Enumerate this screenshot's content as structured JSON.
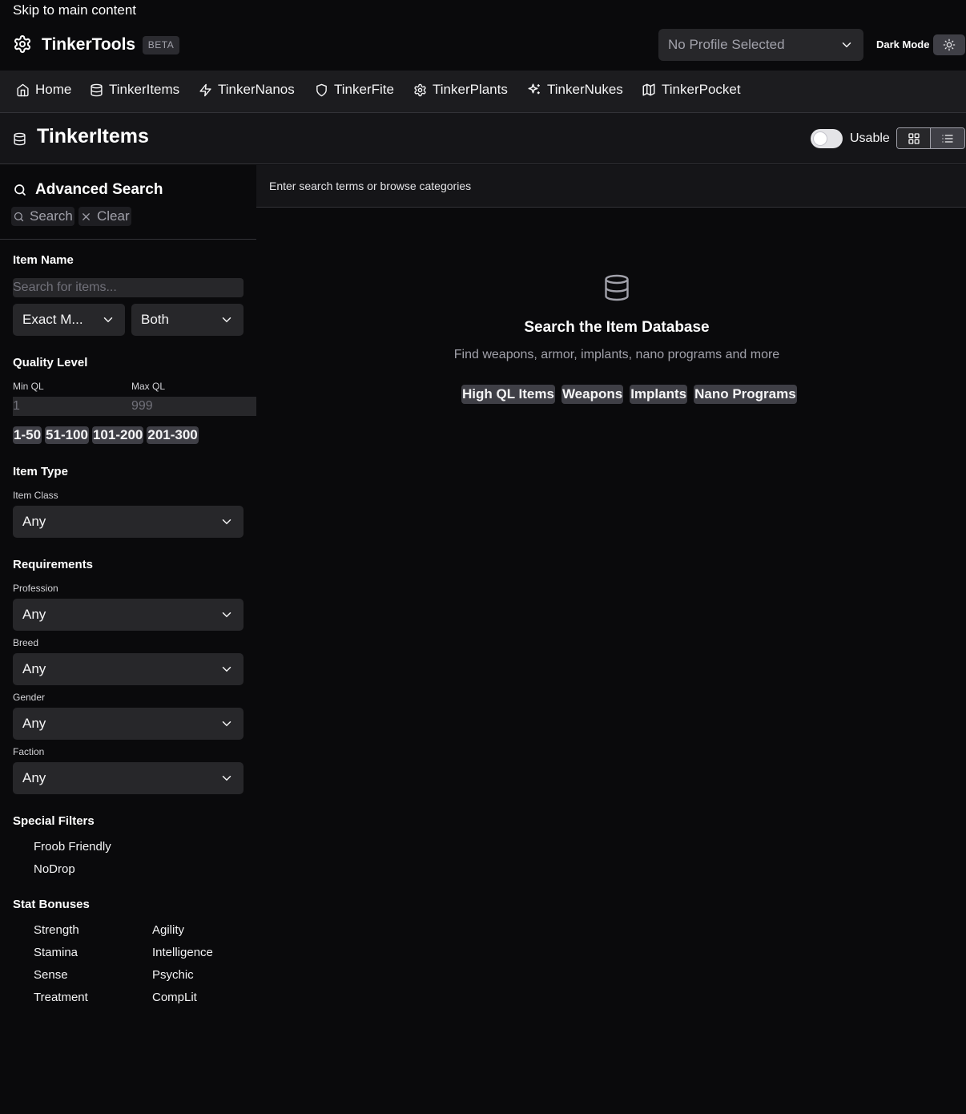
{
  "skip_link": "Skip to main content",
  "app": {
    "name": "TinkerTools",
    "badge": "BETA"
  },
  "profile_select": {
    "value": "No Profile Selected"
  },
  "theme": {
    "label": "Dark Mode"
  },
  "nav": {
    "items": [
      {
        "label": "Home",
        "icon": "home-icon"
      },
      {
        "label": "TinkerItems",
        "icon": "database-icon"
      },
      {
        "label": "TinkerNanos",
        "icon": "zap-icon"
      },
      {
        "label": "TinkerFite",
        "icon": "shield-icon"
      },
      {
        "label": "TinkerPlants",
        "icon": "gear-icon"
      },
      {
        "label": "TinkerNukes",
        "icon": "sparkles-icon"
      },
      {
        "label": "TinkerPocket",
        "icon": "map-icon"
      }
    ]
  },
  "page": {
    "title": "TinkerItems",
    "usable_label": "Usable"
  },
  "sidebar": {
    "heading": "Advanced Search",
    "search_button": "Search",
    "clear_button": "Clear",
    "item_name": {
      "title": "Item Name",
      "placeholder": "Search for items...",
      "match_mode": "Exact M...",
      "scope": "Both"
    },
    "quality": {
      "title": "Quality Level",
      "min_label": "Min QL",
      "max_label": "Max QL",
      "min_placeholder": "1",
      "max_placeholder": "999",
      "presets": [
        "1-50",
        "51-100",
        "101-200",
        "201-300"
      ]
    },
    "item_type": {
      "title": "Item Type",
      "class_label": "Item Class",
      "class_value": "Any"
    },
    "requirements": {
      "title": "Requirements",
      "profession_label": "Profession",
      "profession_value": "Any",
      "breed_label": "Breed",
      "breed_value": "Any",
      "gender_label": "Gender",
      "gender_value": "Any",
      "faction_label": "Faction",
      "faction_value": "Any"
    },
    "special": {
      "title": "Special Filters",
      "options": [
        "Froob Friendly",
        "NoDrop"
      ]
    },
    "stats": {
      "title": "Stat Bonuses",
      "left": [
        "Strength",
        "Stamina",
        "Sense",
        "Treatment"
      ],
      "right": [
        "Agility",
        "Intelligence",
        "Psychic",
        "CompLit"
      ]
    }
  },
  "main": {
    "hint": "Enter search terms or browse categories",
    "empty_title": "Search the Item Database",
    "empty_subtitle": "Find weapons, armor, implants, nano programs and more",
    "categories": [
      "High QL Items",
      "Weapons",
      "Implants",
      "Nano Programs"
    ]
  }
}
